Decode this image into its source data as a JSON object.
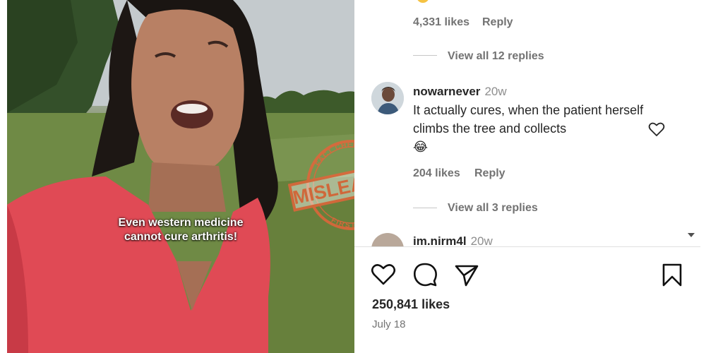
{
  "video": {
    "caption_line1": "Even western medicine",
    "caption_line2": "cannot cure arthritis!",
    "stamp": {
      "top": "FACT CHECKED",
      "main": "MISLEADING",
      "bottom": "FIRST CHECK",
      "color": "#e8633a"
    }
  },
  "comments": {
    "prev": {
      "likes": "4,331 likes",
      "reply_label": "Reply",
      "view_replies": "View all 12 replies"
    },
    "c1": {
      "username": "nowarnever",
      "time": "20w",
      "text": "It actually cures, when the patient herself climbs the tree and collects",
      "emoji": "😂",
      "likes": "204 likes",
      "reply_label": "Reply",
      "view_replies": "View all 3 replies"
    },
    "c2": {
      "username": "im.nirm4l",
      "time": "20w"
    }
  },
  "actions": {
    "likes": "250,841 likes",
    "date": "July 18"
  },
  "icons": [
    "heart-icon",
    "comment-icon",
    "share-icon",
    "bookmark-icon",
    "chevron-down-icon"
  ]
}
